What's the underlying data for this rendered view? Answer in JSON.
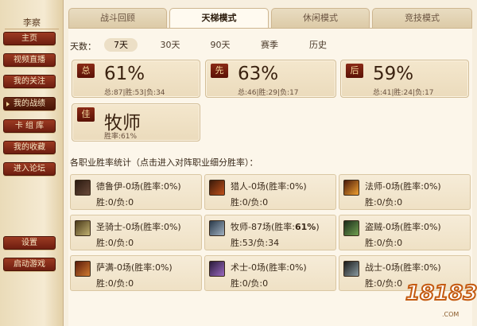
{
  "sidebar": {
    "user": "李察",
    "items": [
      {
        "label": "主页"
      },
      {
        "label": "视频直播"
      },
      {
        "label": "我的关注"
      },
      {
        "label": "我的战绩"
      },
      {
        "label": "卡 组 库"
      },
      {
        "label": "我的收藏"
      },
      {
        "label": "进入论坛"
      },
      {
        "label": "设置"
      },
      {
        "label": "启动游戏"
      }
    ],
    "active_index": 3
  },
  "tabs": [
    {
      "label": "战斗回顾"
    },
    {
      "label": "天梯模式"
    },
    {
      "label": "休闲模式"
    },
    {
      "label": "竞技模式"
    }
  ],
  "active_tab": 1,
  "days": {
    "label": "天数：",
    "options": [
      "7天",
      "30天",
      "90天",
      "赛季",
      "历史"
    ],
    "active": 0
  },
  "stats": [
    {
      "badge": "总",
      "value": "61%",
      "detail": "总:87|胜:53|负:34"
    },
    {
      "badge": "先",
      "value": "63%",
      "detail": "总:46|胜:29|负:17"
    },
    {
      "badge": "后",
      "value": "59%",
      "detail": "总:41|胜:24|负:17"
    }
  ],
  "best": {
    "badge": "佳",
    "name": "牧师",
    "detail": "胜率:61%"
  },
  "section_title": "各职业胜率统计（点击进入对阵职业细分胜率）：",
  "classes": [
    {
      "title": "德鲁伊-0场(胜率:0%)",
      "record": "胜:0/负:0",
      "color": "#5a3a2a"
    },
    {
      "title": "猎人-0场(胜率:0%)",
      "record": "胜:0/负:0",
      "color": "#8a3a1a"
    },
    {
      "title": "法师-0场(胜率:0%)",
      "record": "胜:0/负:0",
      "color": "#b24a1a"
    },
    {
      "title": "圣骑士-0场(胜率:0%)",
      "record": "胜:0/负:0",
      "color": "#7a6a3a"
    },
    {
      "title_prefix": "牧师-87场(胜率:",
      "title_bold": "61%",
      "title_suffix": ")",
      "record": "胜:53/负:34",
      "color": "#4a5a6a"
    },
    {
      "title": "盗贼-0场(胜率:0%)",
      "record": "胜:0/负:0",
      "color": "#3a5a2a"
    },
    {
      "title": "萨满-0场(胜率:0%)",
      "record": "胜:0/负:0",
      "color": "#9a3a1a"
    },
    {
      "title": "术士-0场(胜率:0%)",
      "record": "胜:0/负:0",
      "color": "#5a3a7a"
    },
    {
      "title": "战士-0场(胜率:0%)",
      "record": "胜:0/负:0",
      "color": "#4a4a4a"
    }
  ],
  "watermark": {
    "main": "18183",
    "sub": ".COM"
  }
}
